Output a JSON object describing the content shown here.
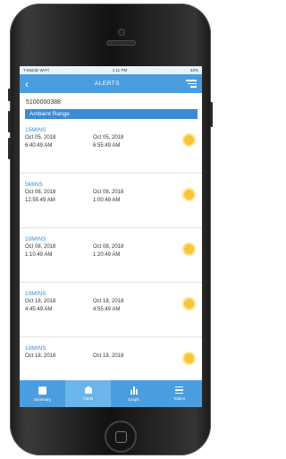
{
  "status_bar": {
    "carrier": "T-Mobile Wi-Fi",
    "time": "1:11 PM",
    "battery": "52%"
  },
  "header": {
    "back_icon": "chevron-left-icon",
    "title": "ALERTS",
    "menu_icon": "menu-icon"
  },
  "device": {
    "id": "5100000388"
  },
  "range": {
    "label": "Ambient Range"
  },
  "alerts": [
    {
      "duration": "15MINS",
      "start_date": "Oct 05, 2018",
      "start_time": "6:40:49 AM",
      "end_date": "Oct 05, 2018",
      "end_time": "6:55:49 AM",
      "icon": "sun-icon"
    },
    {
      "duration": "5MINS",
      "start_date": "Oct 08, 2018",
      "start_time": "12:55:49 AM",
      "end_date": "Oct 08, 2018",
      "end_time": "1:00:49 AM",
      "icon": "sun-icon"
    },
    {
      "duration": "10MINS",
      "start_date": "Oct 08, 2018",
      "start_time": "1:10:49 AM",
      "end_date": "Oct 08, 2018",
      "end_time": "1:20:49 AM",
      "icon": "sun-icon"
    },
    {
      "duration": "10MINS",
      "start_date": "Oct 18, 2018",
      "start_time": "4:45:49 AM",
      "end_date": "Oct 18, 2018",
      "end_time": "4:55:49 AM",
      "icon": "sun-icon"
    },
    {
      "duration": "10MINS",
      "start_date": "Oct 18, 2018",
      "start_time": "",
      "end_date": "Oct 18, 2018",
      "end_time": "",
      "icon": "sun-icon"
    }
  ],
  "tabs": [
    {
      "label": "Summary",
      "icon": "clipboard-icon",
      "active": false
    },
    {
      "label": "Alerts",
      "icon": "bell-icon",
      "active": true
    },
    {
      "label": "Graph",
      "icon": "bar-chart-icon",
      "active": false
    },
    {
      "label": "Tables",
      "icon": "list-icon",
      "active": false
    }
  ],
  "colors": {
    "primary": "#4a9ee0",
    "accent": "#3b8ad6",
    "sun": "#f7c43c"
  }
}
